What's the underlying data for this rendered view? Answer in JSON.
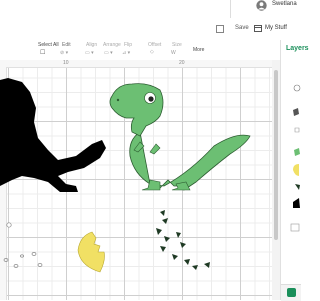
{
  "topbar": {
    "user_name": "Swetlana"
  },
  "header": {
    "save_label": "Save",
    "my_stuff_label": "My Stuff"
  },
  "toolbar": {
    "select_all_label": "Select All",
    "select_all_value": "☐",
    "edit_label": "Edit",
    "align_label": "Align",
    "arrange_label": "Arrange",
    "flip_label": "Flip",
    "offset_label": "Offset",
    "size_label": "Size",
    "more_label": "More",
    "align_value": "▭ ▾",
    "arrange_value": "▭ ▾",
    "flip_value": "⊿ ▾",
    "edit_value": "⊘ ▾",
    "offset_value": "◇",
    "size_value": "W"
  },
  "ruler": {
    "marks": [
      "10",
      "20"
    ]
  },
  "layers": {
    "title": "Layers"
  },
  "colors": {
    "green": "#6cbf73",
    "yellow": "#f1e064",
    "black": "#000000",
    "accent": "#1a8f5a"
  }
}
